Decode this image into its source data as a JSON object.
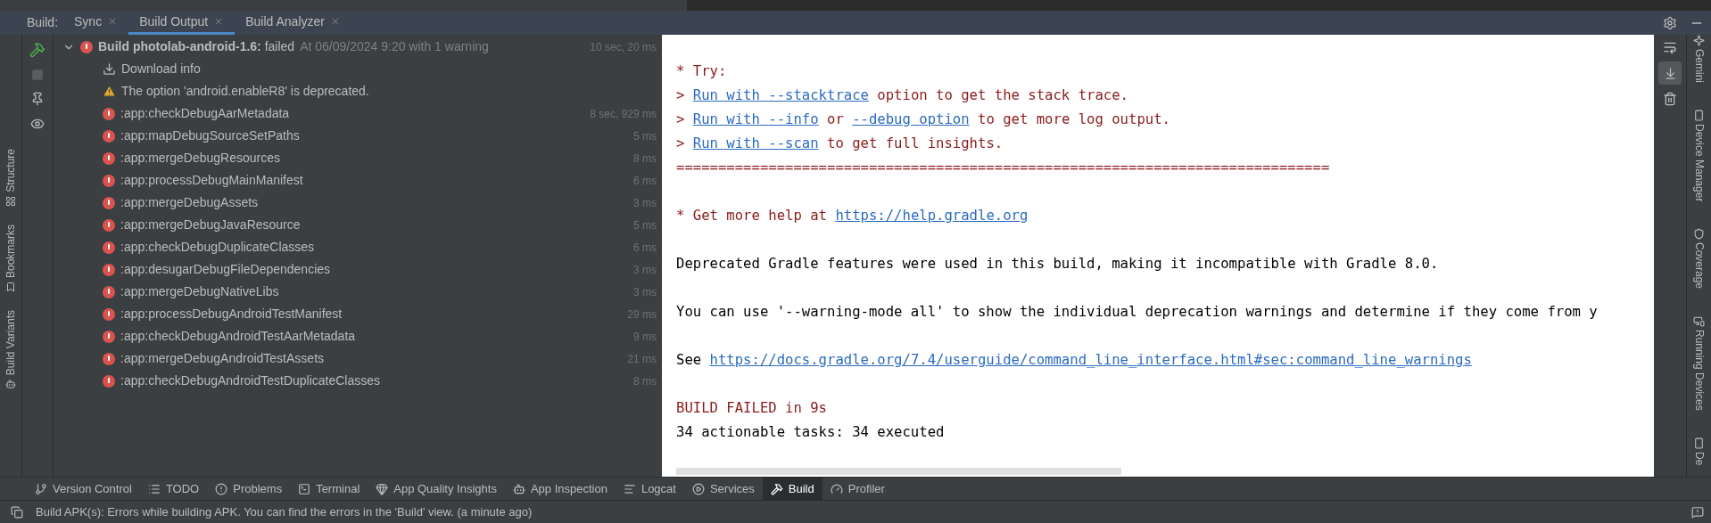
{
  "header": {
    "label": "Build:",
    "tabs": [
      {
        "label": "Sync",
        "selected": false
      },
      {
        "label": "Build Output",
        "selected": true
      },
      {
        "label": "Build Analyzer",
        "selected": false
      }
    ]
  },
  "left_stripe": [
    "Structure",
    "Bookmarks",
    "Build Variants"
  ],
  "tree": {
    "label": "**Build photolab-android-1.6:** failed",
    "detail": "At 06/09/2024 9:20 with 1 warning",
    "duration": "10 sec, 20 ms",
    "expanded": true,
    "kind": "error",
    "children": [
      {
        "kind": "download",
        "label": "Download info"
      },
      {
        "kind": "warning",
        "label": "The option 'android.enableR8' is deprecated."
      },
      {
        "kind": "error",
        "label": ":app:checkDebugAarMetadata",
        "duration": "8 sec, 929 ms"
      },
      {
        "kind": "error",
        "label": ":app:mapDebugSourceSetPaths",
        "duration": "5 ms"
      },
      {
        "kind": "error",
        "label": ":app:mergeDebugResources",
        "duration": "8 ms"
      },
      {
        "kind": "error",
        "label": ":app:processDebugMainManifest",
        "duration": "6 ms"
      },
      {
        "kind": "error",
        "label": ":app:mergeDebugAssets",
        "duration": "3 ms"
      },
      {
        "kind": "error",
        "label": ":app:mergeDebugJavaResource",
        "duration": "5 ms"
      },
      {
        "kind": "error",
        "label": ":app:checkDebugDuplicateClasses",
        "duration": "6 ms"
      },
      {
        "kind": "error",
        "label": ":app:desugarDebugFileDependencies",
        "duration": "3 ms"
      },
      {
        "kind": "error",
        "label": ":app:mergeDebugNativeLibs",
        "duration": "3 ms"
      },
      {
        "kind": "error",
        "label": ":app:processDebugAndroidTestManifest",
        "duration": "29 ms"
      },
      {
        "kind": "error",
        "label": ":app:checkDebugAndroidTestAarMetadata",
        "duration": "9 ms"
      },
      {
        "kind": "error",
        "label": ":app:mergeDebugAndroidTestAssets",
        "duration": "21 ms"
      },
      {
        "kind": "error",
        "label": ":app:checkDebugAndroidTestDuplicateClasses",
        "duration": "8 ms"
      }
    ]
  },
  "console": [
    {
      "lines": [
        {
          "kind": "error",
          "segments": [
            {
              "text": "* Try:",
              "link": false
            }
          ]
        },
        {
          "kind": "error",
          "segments": [
            {
              "text": ">",
              "link": false
            },
            {
              "text": "Run with --stacktrace",
              "link": true
            },
            {
              "text": "option to get the stack trace.",
              "link": false
            }
          ]
        },
        {
          "kind": "error",
          "segments": [
            {
              "text": ">",
              "link": false
            },
            {
              "text": "Run with --info",
              "link": true
            },
            {
              "text": "or",
              "link": false
            },
            {
              "text": "--debug option",
              "link": true
            },
            {
              "text": "to get more log output.",
              "link": false
            }
          ]
        },
        {
          "kind": "error",
          "segments": [
            {
              "text": ">",
              "link": false
            },
            {
              "text": "Run with --scan",
              "link": true
            },
            {
              "text": "to get full insights.",
              "link": false
            }
          ]
        },
        {
          "kind": "error",
          "segments": [
            {
              "text": "==============================================================================",
              "link": false
            }
          ]
        }
      ]
    },
    {
      "lines": [
        {
          "kind": "error",
          "segments": [
            {
              "text": "* Get more help at",
              "link": false
            },
            {
              "text": "https://help.gradle.org",
              "link": true
            }
          ]
        }
      ]
    },
    {
      "lines": [
        {
          "kind": "plain",
          "segments": [
            {
              "text": "Deprecated Gradle features were used in this build, making it incompatible with Gradle 8.0.",
              "link": false
            }
          ]
        }
      ]
    },
    {
      "lines": [
        {
          "kind": "plain",
          "segments": [
            {
              "text": "You can use '--warning-mode all' to show the individual deprecation warnings and determine if they come from y",
              "link": false
            }
          ]
        }
      ]
    },
    {
      "lines": [
        {
          "kind": "plain",
          "segments": [
            {
              "text": "See",
              "link": false
            },
            {
              "text": "https://docs.gradle.org/7.4/userguide/command_line_interface.html#sec:command_line_warnings",
              "link": true
            }
          ]
        }
      ]
    },
    {
      "lines": [
        {
          "kind": "error",
          "segments": [
            {
              "text": "BUILD FAILED in 9s",
              "link": false
            }
          ]
        },
        {
          "kind": "plain",
          "segments": [
            {
              "text": "34 actionable tasks: 34 executed",
              "link": false
            }
          ]
        }
      ]
    }
  ],
  "right_stripe": [
    "Gemini",
    "Device Manager",
    "Coverage",
    "Running Devices",
    "De"
  ],
  "tool_tabs": [
    {
      "label": "Version Control",
      "selected": false
    },
    {
      "label": "TODO",
      "selected": false
    },
    {
      "label": "Problems",
      "selected": false
    },
    {
      "label": "Terminal",
      "selected": false
    },
    {
      "label": "App Quality Insights",
      "selected": false
    },
    {
      "label": "App Inspection",
      "selected": false
    },
    {
      "label": "Logcat",
      "selected": false
    },
    {
      "label": "Services",
      "selected": false
    },
    {
      "label": "Build",
      "selected": true
    },
    {
      "label": "Profiler",
      "selected": false
    }
  ],
  "status_bar": {
    "message": "Build APK(s): Errors while building APK. You can find the errors in the 'Build' view. (a minute ago)"
  }
}
